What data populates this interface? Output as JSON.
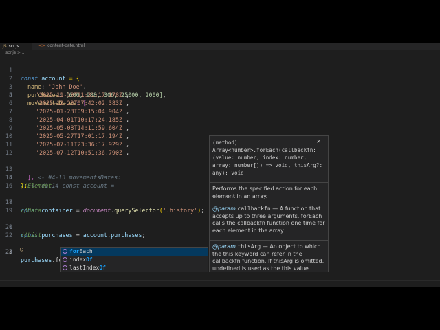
{
  "tabs": [
    {
      "label": "scr.js",
      "active": true
    },
    {
      "label": "content-date.html",
      "active": false
    }
  ],
  "breadcrumb": "scr.js > ...",
  "lines": [
    {
      "n": "1"
    },
    {
      "n": "2"
    },
    {
      "n": "3"
    },
    {
      "n": "4"
    },
    {
      "n": "5"
    },
    {
      "n": "6"
    },
    {
      "n": "7"
    },
    {
      "n": "8"
    },
    {
      "n": "9"
    },
    {
      "n": "10"
    },
    {
      "n": "11"
    },
    {
      "n": "12"
    },
    {
      "n": "13"
    },
    {
      "n": "14"
    },
    {
      "n": "15"
    },
    {
      "n": "16"
    },
    {
      "n": "17"
    },
    {
      "n": "18"
    },
    {
      "n": "19"
    },
    {
      "n": "20"
    },
    {
      "n": "21"
    },
    {
      "n": "22"
    },
    {
      "n": "23"
    },
    {
      "n": "24"
    }
  ],
  "code": {
    "l1": {
      "kw": "const",
      "name": "account",
      "rest": " = {"
    },
    "l2": {
      "prop": "name",
      "val": "'John Doe'"
    },
    "l3": {
      "prop": "purchases",
      "val": "[600, 988, 306, 25000, 2000]"
    },
    "l4": {
      "prop": "movementsDates",
      "rest": ": ["
    },
    "dates": [
      "'2025-11-18T21:31:17.178Z'",
      "'2025-12-23T07:42:02.383Z'",
      "'2025-01-28T09:15:04.904Z'",
      "'2025-04-01T10:17:24.185Z'",
      "'2025-05-08T14:11:59.604Z'",
      "'2025-05-27T17:01:17.194Z'",
      "'2025-07-11T23:36:17.929Z'",
      "'2025-07-12T10:51:36.790Z'"
    ],
    "l13": {
      "punc": "],",
      "hint": "<- #4-13 movementsDates:"
    },
    "l14": {
      "punc": "};",
      "hint": "<- #1-14 const account ="
    },
    "l16": "//Element",
    "l17": {
      "kw": "const",
      "name": "container",
      "obj": "document",
      "fn": "querySelector",
      "arg": "'.history'"
    },
    "l19": "//Data",
    "l20": {
      "kw": "const",
      "name": "purchases",
      "obj": "account",
      "prop": "purchases"
    },
    "l22": "//List",
    "l23": {
      "obj": "purchases",
      "typed": "fo"
    }
  },
  "suggest": {
    "items": [
      {
        "match": "for",
        "rest": "Each"
      },
      {
        "pre": "index",
        "match": "Of",
        "post": ""
      },
      {
        "pre": "lastIndex",
        "match": "Of",
        "post": ""
      }
    ]
  },
  "hover": {
    "signature": "(method) Array<number>.forEach(callbackfn: (value: number, index: number, array: number[]) => void, thisArg?: any): void",
    "close": "×",
    "desc": "Performs the specified action for each element in an array.",
    "param1_tag": "@param",
    "param1_name": "callbackfn",
    "param1_desc": "— A function that accepts up to three arguments. forEach calls the callbackfn function one time for each element in the array.",
    "param2_tag": "@param",
    "param2_name": "thisArg",
    "param2_desc": "— An object to which the this keyword can refer in the callbackfn function. If thisArg is omitted, undefined is used as the this value."
  },
  "colors": {
    "editor_bg": "#1e1e1e",
    "keyword": "#569cd6",
    "string": "#ce9178",
    "number": "#b5cea8",
    "accent": "#18a3ff"
  }
}
